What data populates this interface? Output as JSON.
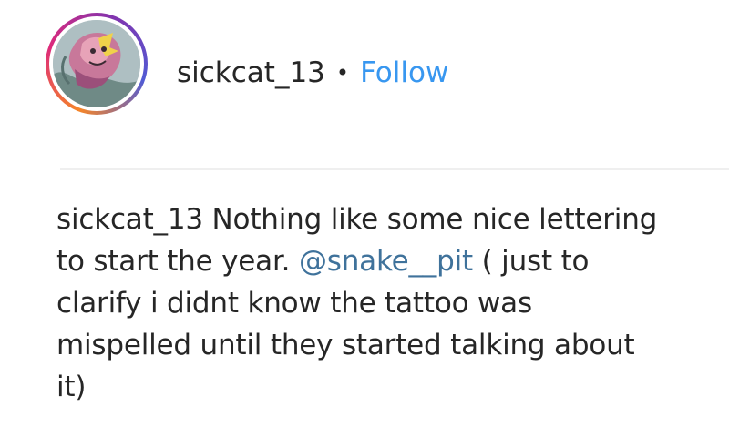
{
  "post": {
    "username": "sickcat_13",
    "separator": "•",
    "follow_label": "Follow",
    "avatar_icon": "profile-avatar-cat-art",
    "caption": {
      "author": "sickcat_13",
      "line1_text": " Nothing like some nice lettering",
      "line2_before": "to start the year. ",
      "mention": "@snake__pit",
      "line2_after": " ( just to",
      "line3": "clarify i didnt know the tattoo was",
      "line4": "mispelled until they started talking about",
      "line5": "it)"
    }
  },
  "colors": {
    "follow_link": "#3897f0",
    "mention_link": "#3f729b",
    "text": "#262626",
    "divider": "#efefef"
  }
}
